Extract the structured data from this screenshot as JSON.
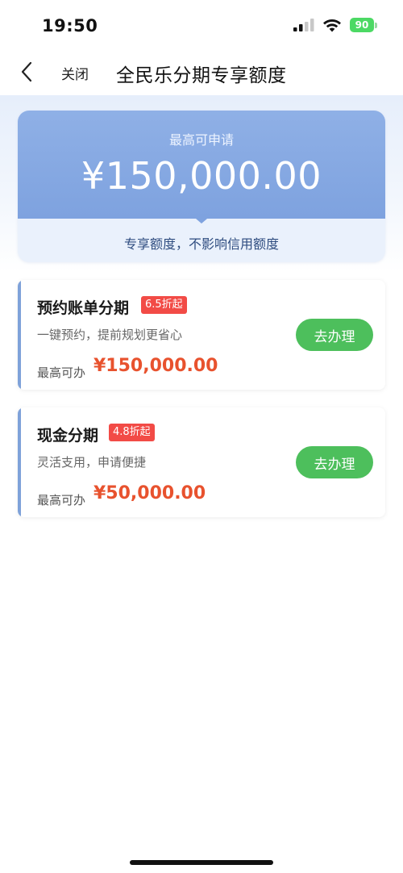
{
  "status_bar": {
    "time": "19:50",
    "battery": "90"
  },
  "nav": {
    "close_label": "关闭",
    "title": "全民乐分期专享额度"
  },
  "quota": {
    "label": "最高可申请",
    "amount": "¥150,000.00",
    "note": "专享额度，不影响信用额度"
  },
  "products": [
    {
      "title": "预约账单分期",
      "badge": "6.5折起",
      "desc": "一键预约，提前规划更省心",
      "limit_label": "最高可办",
      "limit_amount": "¥150,000.00",
      "button": "去办理"
    },
    {
      "title": "现金分期",
      "badge": "4.8折起",
      "desc": "灵活支用，申请便捷",
      "limit_label": "最高可办",
      "limit_amount": "¥50,000.00",
      "button": "去办理"
    }
  ],
  "colors": {
    "accent_blue": "#7fa2d9",
    "action_green": "#4dbf5c",
    "amount_orange": "#e8522e",
    "badge_red": "#f24b46"
  },
  "icons": [
    "cellular-signal-icon",
    "wifi-icon",
    "battery-icon",
    "back-chevron-icon"
  ]
}
